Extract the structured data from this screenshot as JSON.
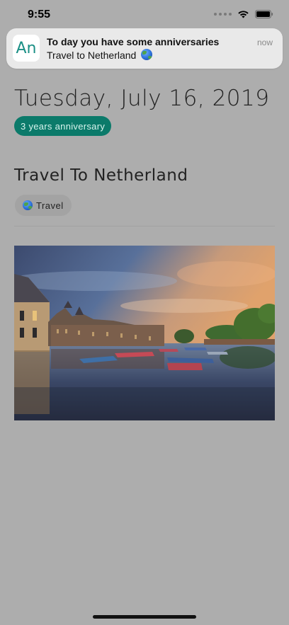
{
  "status_bar": {
    "time": "9:55",
    "icons": [
      "cellular-dots-icon",
      "wifi-icon",
      "battery-icon"
    ]
  },
  "notification": {
    "app_icon_text": "An",
    "title": "To day you have some anniversaries",
    "body": "Travel to Netherland",
    "body_emoji": "globe-icon",
    "time": "now"
  },
  "event": {
    "date": "Tuesday, July 16, 2019",
    "anniversary_badge": "3 years anniversary",
    "title": "Travel To Netherland",
    "category": "Travel",
    "category_icon": "globe-icon"
  },
  "colors": {
    "background": "#adadad",
    "badge": "#0b7a6a",
    "app_icon_text": "#1a8f85"
  }
}
